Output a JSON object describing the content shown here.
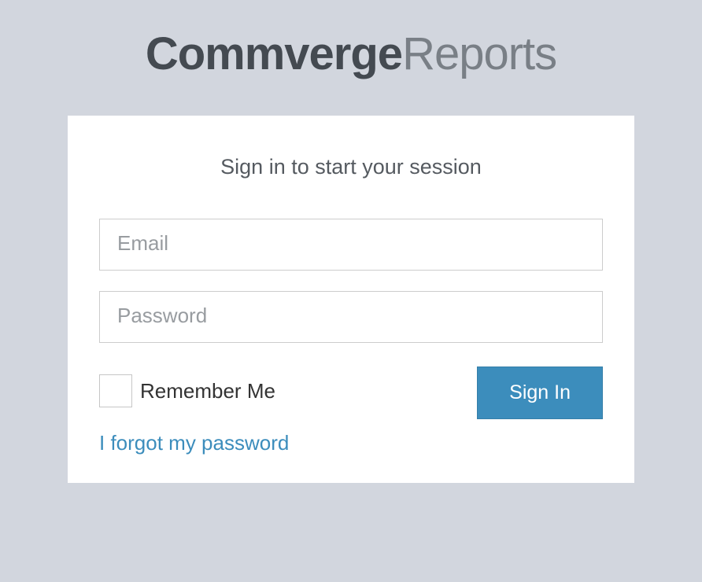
{
  "brand": {
    "bold": "Commverge",
    "light": "Reports"
  },
  "login": {
    "subtitle": "Sign in to start your session",
    "email_placeholder": "Email",
    "password_placeholder": "Password",
    "remember_label": "Remember Me",
    "signin_label": "Sign In",
    "forgot_label": "I forgot my password"
  },
  "colors": {
    "background": "#d2d6de",
    "accent": "#3c8dbc"
  }
}
